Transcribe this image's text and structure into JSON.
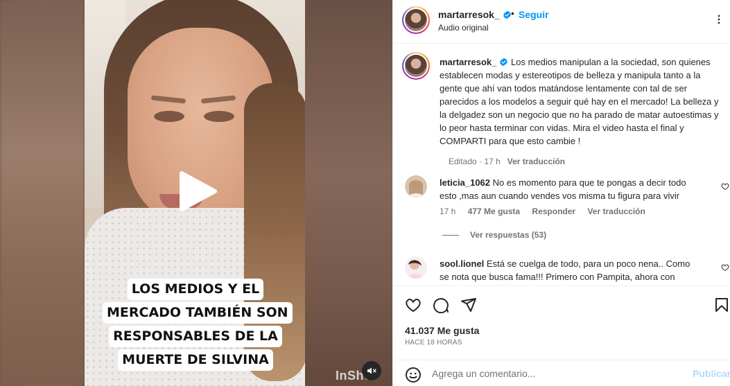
{
  "post": {
    "username": "martarresok_",
    "follow_label": "Seguir",
    "separator": "•",
    "audio": "Audio original",
    "more_icon": "more-horizontal-icon",
    "verified_color": "#0095f6"
  },
  "video": {
    "overlay_lines": [
      "LOS MEDIOS Y EL",
      "MERCADO TAMBIÉN SON",
      "RESPONSABLES DE LA",
      "MUERTE DE SILVINA"
    ],
    "watermark": "InShot",
    "play_icon": "play-icon",
    "mute_icon": "muted-speaker-icon"
  },
  "caption": {
    "username": "martarresok_",
    "text": "Los medios manipulan a la sociedad, son quienes establecen modas y estereotipos de belleza y manipula tanto a la gente que ahí van todos matándose lentamente con tal de ser parecidos a los modelos a seguir qué hay en el mercado! La belleza y la delgadez son un negocio que no ha parado de matar autoestimas y lo peor hasta terminar con vidas. Mira el video hasta el final y COMPARTI para que esto cambie !",
    "edited": "Editado",
    "dot": "·",
    "age": "17 h",
    "translate": "Ver traducción"
  },
  "comments": [
    {
      "username": "leticia_1062",
      "text": "No es momento para que te pongas a decir todo esto ,mas aun cuando vendes vos misma tu figura para vivir",
      "age": "17 h",
      "likes": "477 Me gusta",
      "reply": "Responder",
      "translate": "Ver traducción",
      "replies": "Ver respuestas (53)"
    },
    {
      "username": "sool.lionel",
      "text": "Está se cuelga de todo, para un poco nena.. Como se nota que busca fama!!! Primero con Pampita, ahora con"
    }
  ],
  "actions": {
    "like_icon": "heart-icon",
    "comment_icon": "comment-bubble-icon",
    "share_icon": "share-arrow-icon",
    "save_icon": "bookmark-icon",
    "likes": "41.037 Me gusta",
    "time": "HACE 18 HORAS"
  },
  "add_comment": {
    "placeholder": "Agrega un comentario...",
    "publish": "Publicar",
    "emoji_icon": "emoji-smiley-icon",
    "publish_color": "#b3dbff"
  }
}
